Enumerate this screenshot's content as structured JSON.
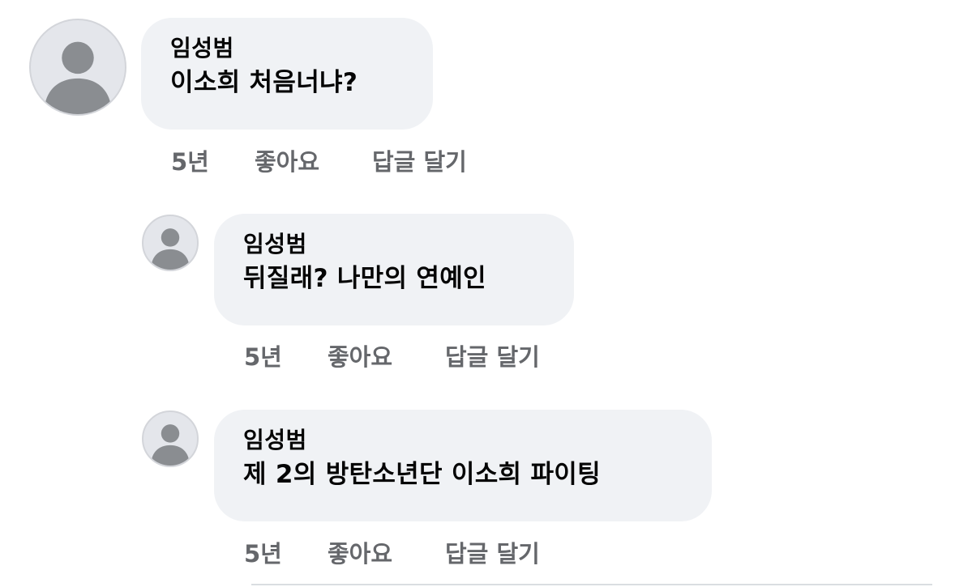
{
  "comments": [
    {
      "author": "임성범",
      "text": "이소희 처음너냐?",
      "time": "5년",
      "like_label": "좋아요",
      "reply_label": "답글 달기"
    },
    {
      "author": "임성범",
      "text": "뒤질래? 나만의 연예인",
      "time": "5년",
      "like_label": "좋아요",
      "reply_label": "답글 달기"
    },
    {
      "author": "임성범",
      "text": "제 2의 방탄소년단 이소희 파이팅",
      "time": "5년",
      "like_label": "좋아요",
      "reply_label": "답글 달기"
    }
  ],
  "colors": {
    "bubble_bg": "#f0f2f5",
    "avatar_bg": "#e4e6eb",
    "avatar_silhouette": "#8a8d91",
    "action_text": "#65676b",
    "primary_text": "#050505"
  },
  "icons": {
    "avatar": "default-profile-silhouette-icon"
  }
}
